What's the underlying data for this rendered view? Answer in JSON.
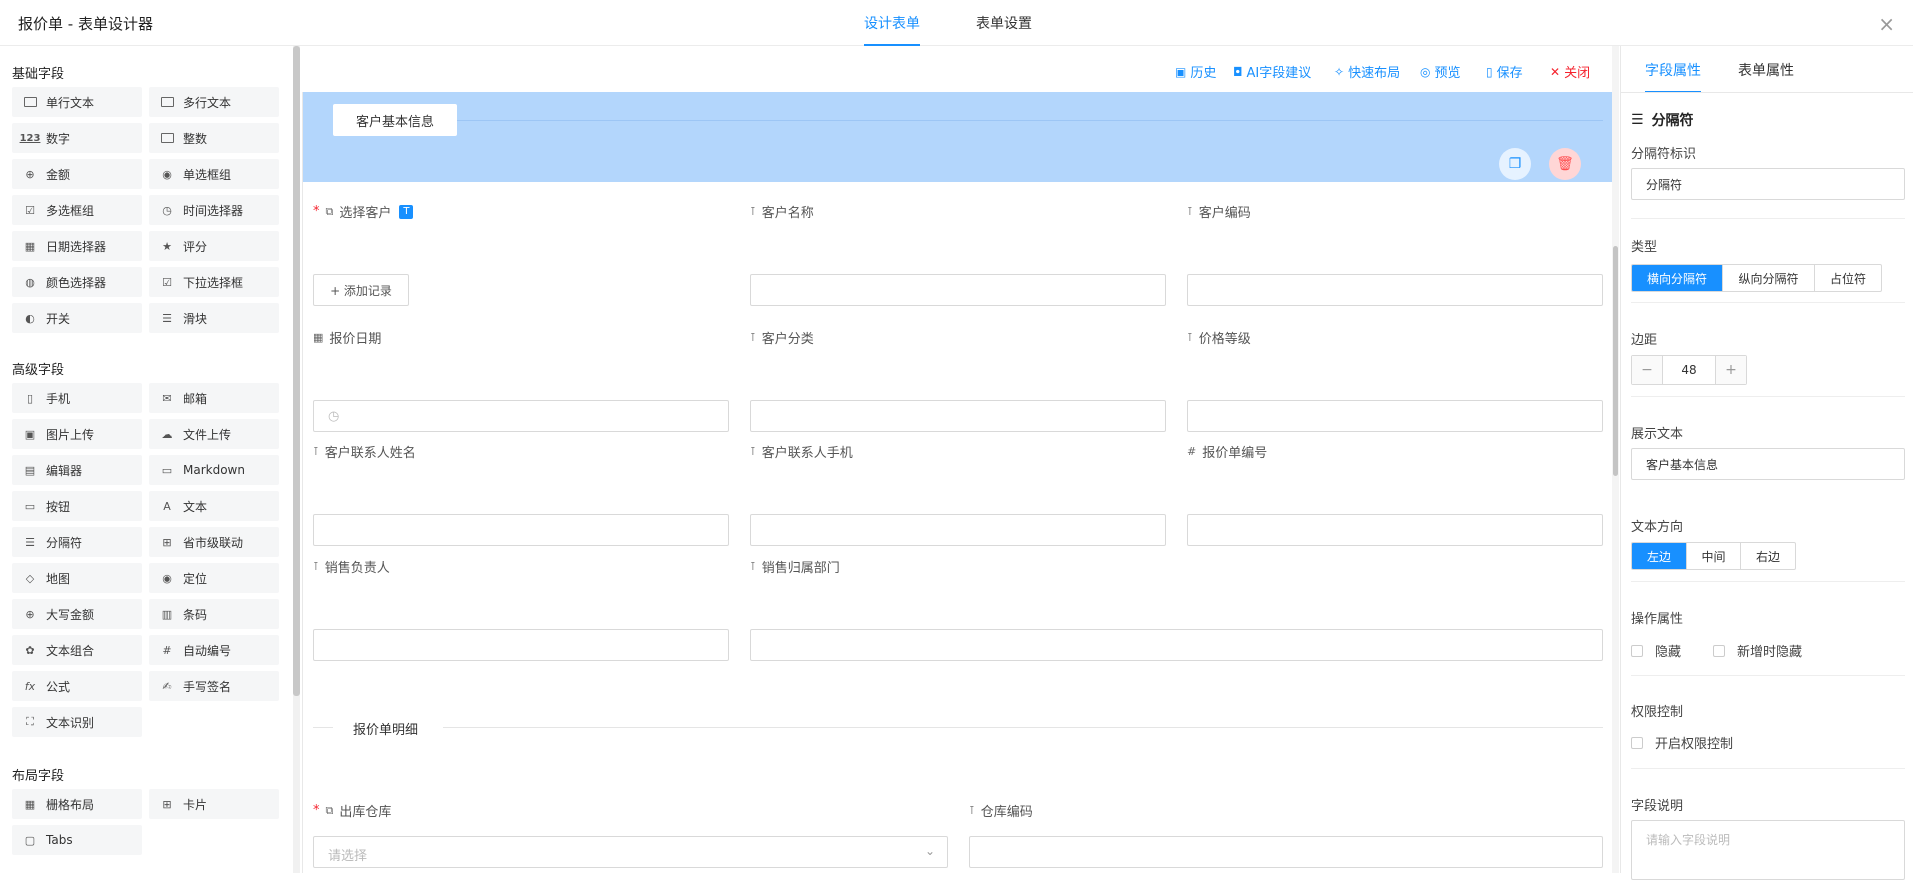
{
  "header": {
    "title": "报价单 - 表单设计器",
    "tabs": [
      "设计表单",
      "表单设置"
    ],
    "close_glyph": "×"
  },
  "palette": {
    "basic": {
      "title": "基础字段",
      "items": [
        "单行文本",
        "多行文本",
        "数字",
        "整数",
        "金额",
        "单选框组",
        "多选框组",
        "时间选择器",
        "日期选择器",
        "评分",
        "颜色选择器",
        "下拉选择框",
        "开关",
        "滑块"
      ]
    },
    "advanced": {
      "title": "高级字段",
      "items": [
        "手机",
        "邮箱",
        "图片上传",
        "文件上传",
        "编辑器",
        "Markdown",
        "按钮",
        "文本",
        "分隔符",
        "省市级联动",
        "地图",
        "定位",
        "大写金额",
        "条码",
        "文本组合",
        "自动编号",
        "公式",
        "手写签名",
        "文本识别"
      ]
    },
    "layout": {
      "title": "布局字段",
      "items": [
        "栅格布局",
        "卡片",
        "Tabs"
      ]
    }
  },
  "toolbar": {
    "history": "历史",
    "ai": "AI字段建议",
    "quick": "快速布局",
    "preview": "预览",
    "save": "保存",
    "close": "关闭"
  },
  "form": {
    "divider1": "客户基本信息",
    "add_record": "+ 添加记录",
    "fields": {
      "customer_select": "选择客户",
      "customer_name": "客户名称",
      "customer_code": "客户编码",
      "quote_date": "报价日期",
      "customer_category": "客户分类",
      "price_level": "价格等级",
      "contact_name": "客户联系人姓名",
      "contact_phone": "客户联系人手机",
      "quote_no": "报价单编号",
      "sales_owner": "销售负责人",
      "sales_dept": "销售归属部门",
      "warehouse": "出库仓库",
      "warehouse_code": "仓库编码"
    },
    "section2": "报价单明细",
    "warehouse_placeholder": "请选择",
    "tag_t": "T"
  },
  "props": {
    "tabs": [
      "字段属性",
      "表单属性"
    ],
    "component": "分隔符",
    "id_label": "分隔符标识",
    "id_value": "分隔符",
    "type_label": "类型",
    "type_options": [
      "横向分隔符",
      "纵向分隔符",
      "占位符"
    ],
    "margin_label": "边距",
    "margin_value": "48",
    "text_label": "展示文本",
    "text_value": "客户基本信息",
    "dir_label": "文本方向",
    "dir_options": [
      "左边",
      "中间",
      "右边"
    ],
    "ops_label": "操作属性",
    "ops_hidden": "隐藏",
    "ops_hidden_new": "新增时隐藏",
    "perm_label": "权限控制",
    "perm_enable": "开启权限控制",
    "desc_label": "字段说明",
    "desc_placeholder": "请输入字段说明"
  },
  "colors": {
    "accent": "#1890ff",
    "danger": "#f5222d",
    "selected_bg": "#b3d6fc"
  }
}
